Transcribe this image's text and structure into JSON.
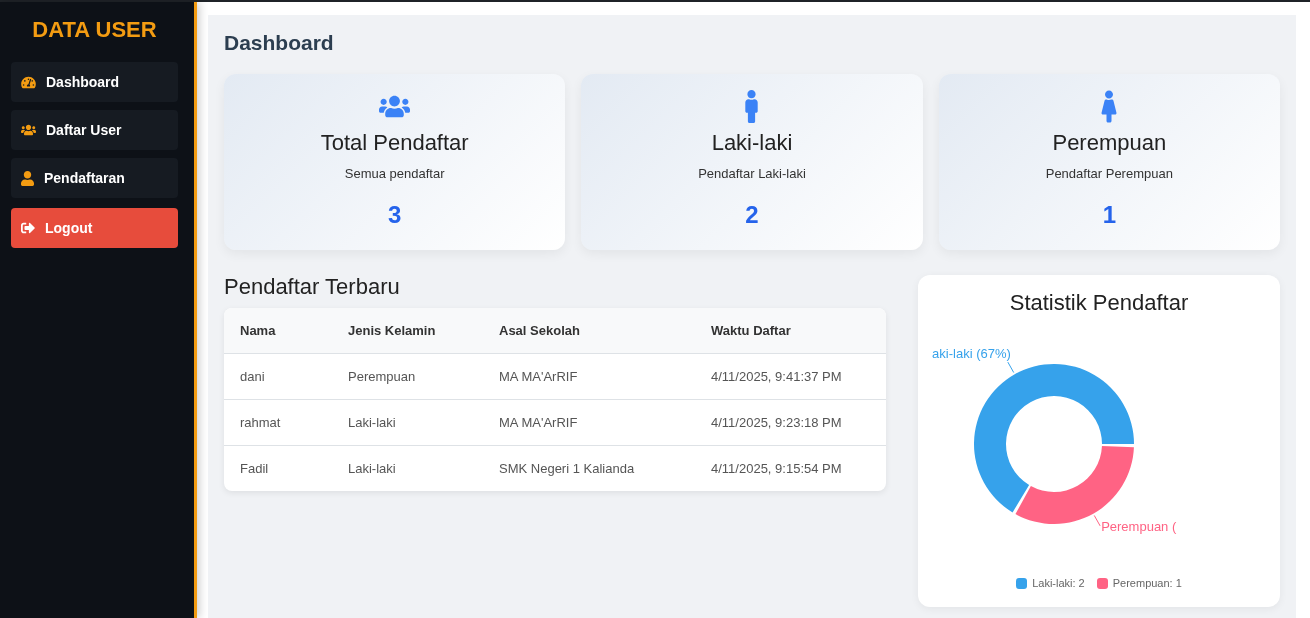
{
  "sidebar": {
    "title": "DATA USER",
    "items": [
      {
        "kind": "nav",
        "label": "Dashboard"
      },
      {
        "kind": "nav",
        "label": "Daftar User"
      },
      {
        "kind": "nav",
        "label": "Pendaftaran"
      },
      {
        "kind": "logout",
        "label": "Logout"
      }
    ]
  },
  "page_title": "Dashboard",
  "summary_cards": [
    {
      "title": "Total Pendaftar",
      "subtitle": "Semua pendaftar",
      "count": "3"
    },
    {
      "title": "Laki-laki",
      "subtitle": "Pendaftar Laki-laki",
      "count": "2"
    },
    {
      "title": "Perempuan",
      "subtitle": "Pendaftar Perempuan",
      "count": "1"
    }
  ],
  "recent_table": {
    "title": "Pendaftar Terbaru",
    "columns": [
      "Nama",
      "Jenis Kelamin",
      "Asal Sekolah",
      "Waktu Daftar"
    ],
    "rows": [
      [
        "dani",
        "Perempuan",
        "MA MA'ArRIF",
        "4/11/2025, 9:41:37 PM"
      ],
      [
        "rahmat",
        "Laki-laki",
        "MA MA'ArRIF",
        "4/11/2025, 9:23:18 PM"
      ],
      [
        "Fadil",
        "Laki-laki",
        "SMK Negeri 1 Kalianda",
        "4/11/2025, 9:15:54 PM"
      ]
    ]
  },
  "statistics": {
    "chart_data": {
      "type": "donut",
      "title": "Statistik Pendaftar",
      "values": [
        67,
        33
      ]
    },
    "slice_labels": [
      "aki-laki (67%)",
      "Perempuan ("
    ],
    "legend": [
      {
        "label": "Laki-laki: 2",
        "color": "#36a2eb"
      },
      {
        "label": "Perempuan: 1",
        "color": "#ff6384"
      }
    ]
  }
}
